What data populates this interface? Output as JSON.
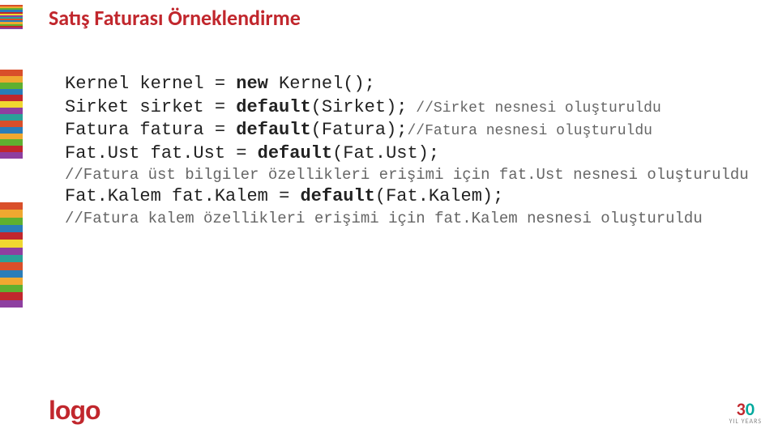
{
  "title": "Satış Faturası Örneklendirme",
  "code": {
    "l1_type": "Kernel",
    "l1_var": "kernel",
    "l1_op": "=",
    "l1_kw": "new",
    "l1_rest": " Kernel();",
    "l2_type": "Sirket",
    "l2_var": "sirket",
    "l2_op": "=",
    "l2_kw": "default",
    "l2_rest": "(Sirket);",
    "l2_c": " //Sirket nesnesi oluşturuldu",
    "l3_type": "Fatura",
    "l3_var": "fatura",
    "l3_op": "=",
    "l3_kw": "default",
    "l3_rest": "(Fatura);",
    "l3_c": "//Fatura nesnesi oluşturuldu",
    "l4_type": "Fat.Ust",
    "l4_var": "fat.Ust",
    "l4_op": "=",
    "l4_kw": "default",
    "l4_rest": "(Fat.Ust);",
    "c5": "//Fatura üst bilgiler özellikleri erişimi için fat.Ust nesnesi oluşturuldu",
    "l6_type": "Fat.Kalem",
    "l6_var": "fat.Kalem",
    "l6_op": "=",
    "l6_kw": "default",
    "l6_rest": "(Fat.Kalem);",
    "c7": "//Fatura kalem özellikleri erişimi için fat.Kalem nesnesi oluşturuldu"
  },
  "logo": "logo",
  "badge": {
    "n3": "3",
    "n0": "0",
    "yrs": "YIL YEARS"
  },
  "stripe_colors": [
    "#d94f2a",
    "#f0a830",
    "#5fb030",
    "#2a7db8",
    "#c1272d",
    "#f0d830",
    "#8e3fa0",
    "#2aa198",
    "#d94f2a",
    "#2a7db8",
    "#f0a830",
    "#5fb030",
    "#c1272d",
    "#8e3fa0"
  ]
}
